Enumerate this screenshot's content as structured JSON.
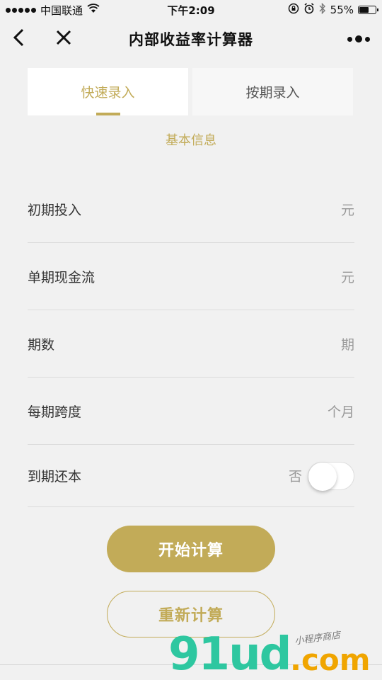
{
  "status_bar": {
    "carrier": "中国联通",
    "time": "下午2:09",
    "battery": "55%"
  },
  "nav": {
    "title": "内部收益率计算器"
  },
  "tabs": [
    {
      "label": "快速录入",
      "active": true
    },
    {
      "label": "按期录入",
      "active": false
    }
  ],
  "section_title": "基本信息",
  "form": {
    "rows": [
      {
        "label": "初期投入",
        "unit": "元"
      },
      {
        "label": "单期现金流",
        "unit": "元"
      },
      {
        "label": "期数",
        "unit": "期"
      },
      {
        "label": "每期跨度",
        "unit": "个月"
      }
    ],
    "toggle_row": {
      "label": "到期还本",
      "value_text": "否",
      "on": false
    }
  },
  "buttons": {
    "calculate": "开始计算",
    "reset": "重新计算"
  },
  "watermark": {
    "main": "91ud",
    "domain": ".com",
    "tagline": "小程序商店"
  },
  "colors": {
    "accent": "#c2ab58",
    "background": "#f1f1f1"
  }
}
